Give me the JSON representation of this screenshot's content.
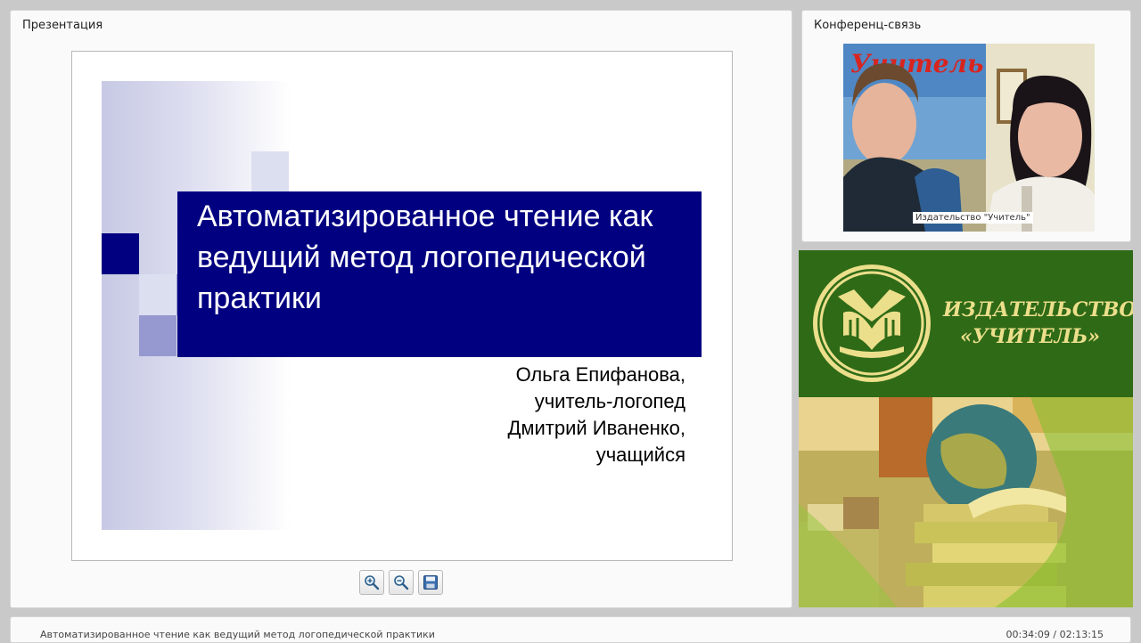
{
  "presentation_panel": {
    "title": "Презентация"
  },
  "slide": {
    "title": "Автоматизированное чтение как ведущий метод логопедической практики",
    "authors": [
      "Ольга Епифанова,",
      "учитель-логопед",
      "Дмитрий Иваненко,",
      "учащийся"
    ]
  },
  "toolbar": {
    "zoom_in_icon": "zoom-in-icon",
    "zoom_out_icon": "zoom-out-icon",
    "save_icon": "save-icon"
  },
  "conference_panel": {
    "title": "Конференц-связь",
    "video_caption": "Издательство \"Учитель\""
  },
  "publisher": {
    "name_line1": "ИЗДАТЕЛЬСТВО",
    "name_line2": "«УЧИТЕЛЬ»",
    "brand_green": "#2f6a17",
    "brand_gold": "#ecdf8b"
  },
  "status_bar": {
    "title": "Автоматизированное чтение как ведущий метод логопедической практики",
    "time": "00:34:09 / 02:13:15"
  },
  "colors": {
    "slide_navy": "#000080",
    "slide_lavender": "#9699cf"
  }
}
